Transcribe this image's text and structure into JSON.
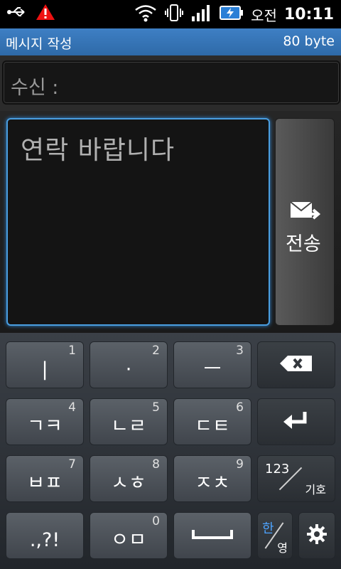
{
  "statusbar": {
    "ampm": "오전",
    "clock": "10:11"
  },
  "titlebar": {
    "title": "메시지 작성",
    "bytes": "80 byte"
  },
  "recipient": {
    "label": "수신 :"
  },
  "message": {
    "text": "연락 바랍니다"
  },
  "send": {
    "label": "전송"
  },
  "keyboard": {
    "row1": [
      {
        "main": "|",
        "num": "1"
      },
      {
        "main": "·",
        "num": "2"
      },
      {
        "main": "ㅡ",
        "num": "3"
      }
    ],
    "row2": [
      {
        "main": "ㄱㅋ",
        "num": "4"
      },
      {
        "main": "ㄴㄹ",
        "num": "5"
      },
      {
        "main": "ㄷㅌ",
        "num": "6"
      }
    ],
    "row3": [
      {
        "main": "ㅂㅍ",
        "num": "7"
      },
      {
        "main": "ㅅㅎ",
        "num": "8"
      },
      {
        "main": "ㅈㅊ",
        "num": "9"
      }
    ],
    "row4": [
      {
        "main": ".,?!"
      },
      {
        "main": "ㅇㅁ",
        "num": "0"
      }
    ],
    "symbol_key": {
      "top": "123",
      "bottom": "기호"
    },
    "language_key": {
      "top": "한",
      "bottom": "영",
      "top_color": "#4da3ff"
    }
  }
}
